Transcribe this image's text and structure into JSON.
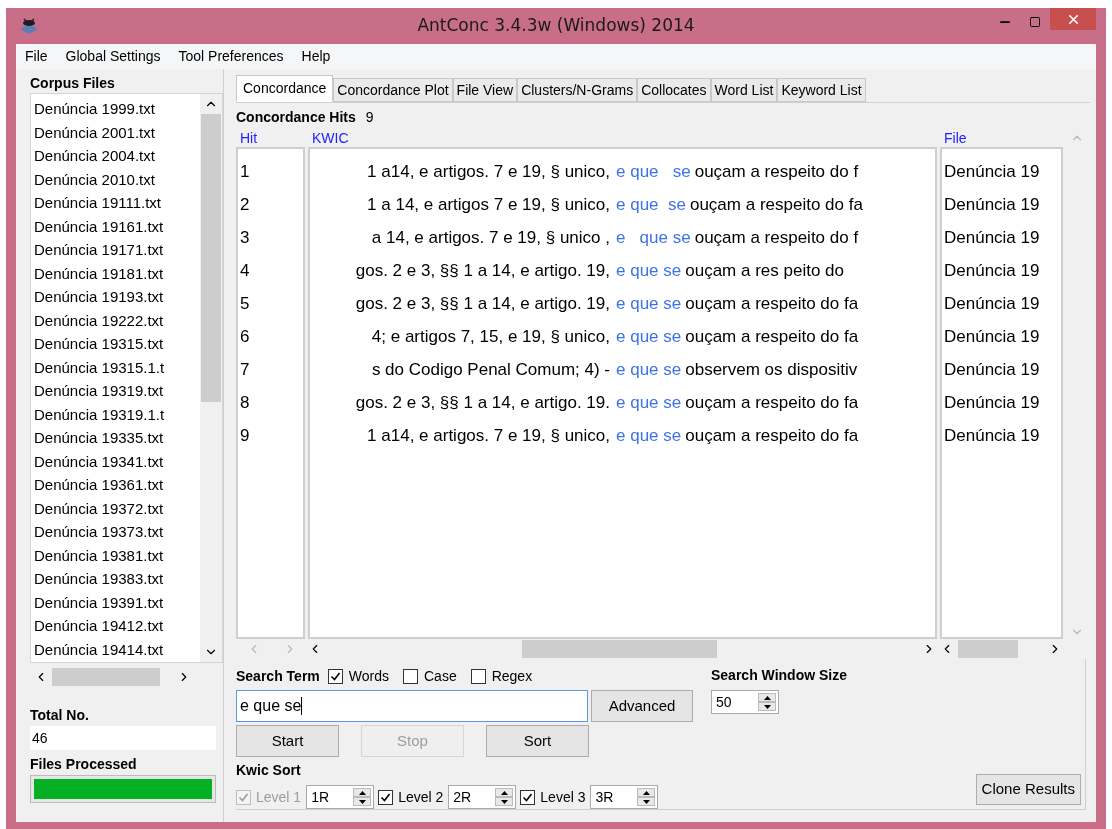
{
  "window": {
    "title": "AntConc 3.4.3w (Windows) 2014"
  },
  "menu": [
    "File",
    "Global Settings",
    "Tool Preferences",
    "Help"
  ],
  "corpus_files": {
    "title": "Corpus Files",
    "files": [
      "Denúncia 1999.txt",
      "Denúncia 2001.txt",
      "Denúncia 2004.txt",
      "Denúncia 2010.txt",
      "Denúncia 19111.txt",
      "Denúncia 19161.txt",
      "Denúncia 19171.txt",
      "Denúncia 19181.txt",
      "Denúncia 19193.txt",
      "Denúncia 19222.txt",
      "Denúncia 19315.txt",
      "Denúncia 19315.1.t",
      "Denúncia 19319.txt",
      "Denúncia 19319.1.t",
      "Denúncia 19335.txt",
      "Denúncia 19341.txt",
      "Denúncia 19361.txt",
      "Denúncia 19372.txt",
      "Denúncia 19373.txt",
      "Denúncia 19381.txt",
      "Denúncia 19383.txt",
      "Denúncia 19391.txt",
      "Denúncia 19412.txt",
      "Denúncia 19414.txt"
    ]
  },
  "total_no": {
    "label": "Total No.",
    "value": "46"
  },
  "files_processed": {
    "label": "Files Processed",
    "level": 1
  },
  "tabs": [
    {
      "label": "Concordance",
      "selected": true
    },
    {
      "label": "Concordance Plot",
      "selected": false
    },
    {
      "label": "File View",
      "selected": false
    },
    {
      "label": "Clusters/N-Grams",
      "selected": false
    },
    {
      "label": "Collocates",
      "selected": false
    },
    {
      "label": "Word List",
      "selected": false
    },
    {
      "label": "Keyword List",
      "selected": false
    }
  ],
  "concordance_hits": {
    "label": "Concordance Hits",
    "value": "9"
  },
  "table": {
    "columns": [
      "Hit",
      "KWIC",
      "File"
    ],
    "rows": [
      {
        "hit": "1",
        "left": "1 a14, e artigos. 7 e 19, § unico,",
        "keyword": "e que   se",
        "right": "ouçam a respeito do f",
        "file": "Denúncia 19"
      },
      {
        "hit": "2",
        "left": "1 a 14, e artigos 7 e 19, § unico,",
        "keyword": "e que  se",
        "right": "ouçam a respeito do fa",
        "file": "Denúncia 19"
      },
      {
        "hit": "3",
        "left": "a 14, e artigos. 7 e 19, § unico ,",
        "keyword": "e   que se",
        "right": "ouçam a respeito do f",
        "file": "Denúncia 19"
      },
      {
        "hit": "4",
        "left": "gos. 2 e 3, §§ 1 a 14, e artigo. 19,",
        "keyword": "e que se",
        "right": "ouçam a res peito do",
        "file": "Denúncia 19"
      },
      {
        "hit": "5",
        "left": "gos. 2 e 3, §§ 1 a 14, e artigo. 19,",
        "keyword": "e que se",
        "right": "ouçam a  respeito do fa",
        "file": "Denúncia 19"
      },
      {
        "hit": "6",
        "left": "4; e artigos  7, 15, e 19, § unico,",
        "keyword": "e que se",
        "right": "ouçam a respeito do fa",
        "file": "Denúncia 19"
      },
      {
        "hit": "7",
        "left": "s do Codigo Penal Comum; 4) -",
        "keyword": "e que se",
        "right": "observem os dispositiv",
        "file": "Denúncia 19"
      },
      {
        "hit": "8",
        "left": "gos. 2 e 3, §§ 1 a 14, e artigo. 19.",
        "keyword": "e que se",
        "right": "ouçam a respeito do fa",
        "file": "Denúncia 19"
      },
      {
        "hit": "9",
        "left": "1 a14, e artigos. 7 e 19, § unico,",
        "keyword": "e que se",
        "right": "ouçam a respeito do fa",
        "file": "Denúncia 19"
      }
    ]
  },
  "search": {
    "label": "Search Term",
    "options": [
      {
        "label": "Words",
        "checked": true
      },
      {
        "label": "Case",
        "checked": false
      },
      {
        "label": "Regex",
        "checked": false
      }
    ],
    "value": "e que se",
    "advanced": "Advanced"
  },
  "buttons": [
    {
      "label": "Start",
      "disabled": false
    },
    {
      "label": "Stop",
      "disabled": true
    },
    {
      "label": "Sort",
      "disabled": false
    }
  ],
  "search_window_size": {
    "label": "Search Window Size",
    "value": "50"
  },
  "kwic_sort": {
    "label": "Kwic Sort",
    "levels": [
      {
        "label": "Level 1",
        "value": "1R",
        "checked": true,
        "disabled": true
      },
      {
        "label": "Level 2",
        "value": "2R",
        "checked": true,
        "disabled": false
      },
      {
        "label": "Level 3",
        "value": "3R",
        "checked": true,
        "disabled": false
      }
    ]
  },
  "clone_results": "Clone Results"
}
